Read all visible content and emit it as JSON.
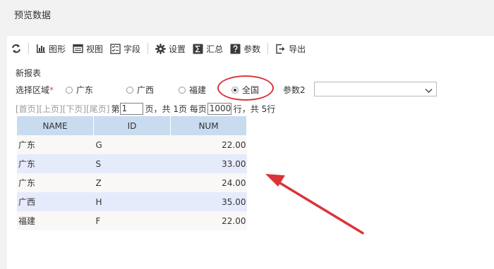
{
  "window": {
    "title": "预览数据"
  },
  "toolbar": {
    "items": [
      {
        "label": "",
        "icon": "refresh-icon"
      },
      {
        "label": "图形",
        "icon": "bar-chart-icon"
      },
      {
        "label": "视图",
        "icon": "view-icon"
      },
      {
        "label": "字段",
        "icon": "fields-icon"
      },
      {
        "label": "设置",
        "icon": "gear-icon"
      },
      {
        "label": "汇总",
        "icon": "sigma-icon"
      },
      {
        "label": "参数",
        "icon": "question-icon"
      },
      {
        "label": "导出",
        "icon": "export-icon"
      }
    ]
  },
  "report": {
    "name": "新报表"
  },
  "filter": {
    "label": "选择区域",
    "required_mark": "*",
    "options": [
      "广东",
      "广西",
      "福建",
      "全国"
    ],
    "selected": "全国",
    "param2_label": "参数2",
    "param2_value": ""
  },
  "pager": {
    "first": "[首页]",
    "prev": "[上页]",
    "next": "[下页]",
    "last": "[尾页]",
    "page_prefix": "第",
    "page_value": "1",
    "page_suffix": "页，共 1页 每页",
    "per_page_value": "1000",
    "rows_suffix": "行，共 5行"
  },
  "table": {
    "columns": [
      "NAME",
      "ID",
      "NUM"
    ],
    "rows": [
      [
        "广东",
        "G",
        "22.00"
      ],
      [
        "广东",
        "S",
        "33.00"
      ],
      [
        "广东",
        "Z",
        "24.00"
      ],
      [
        "广西",
        "H",
        "35.00"
      ],
      [
        "福建",
        "F",
        "22.00"
      ]
    ]
  },
  "colors": {
    "annotation_red": "#d9343a",
    "header_bg": "#c9dbef",
    "row_alt_bg": "#e6ebfb"
  }
}
